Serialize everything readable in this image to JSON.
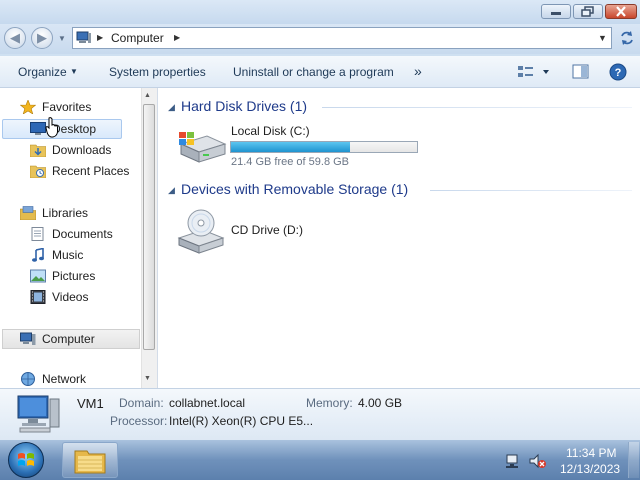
{
  "window": {
    "controls": [
      "minimize",
      "maximize",
      "close"
    ]
  },
  "address": {
    "location": "Computer",
    "separator": "▶",
    "history_arrow": "▼"
  },
  "toolbar": {
    "organize_label": "Organize",
    "system_properties_label": "System properties",
    "uninstall_label": "Uninstall or change a program",
    "more_label": "»"
  },
  "nav": {
    "favorites": "Favorites",
    "desktop": "Desktop",
    "downloads": "Downloads",
    "recent_places": "Recent Places",
    "libraries": "Libraries",
    "documents": "Documents",
    "music": "Music",
    "pictures": "Pictures",
    "videos": "Videos",
    "computer": "Computer",
    "network": "Network"
  },
  "main": {
    "hard_disk_header": "Hard Disk Drives (1)",
    "local_disk_name": "Local Disk (C:)",
    "local_disk_free": "21.4 GB free of 59.8 GB",
    "local_disk_used_fraction": 0.642,
    "removable_header": "Devices with Removable Storage (1)",
    "cd_drive_name": "CD Drive (D:)"
  },
  "details": {
    "computer_name": "VM1",
    "domain_label": "Domain:",
    "domain_value": "collabnet.local",
    "memory_label": "Memory:",
    "memory_value": "4.00 GB",
    "processor_label": "Processor:",
    "processor_value": "Intel(R) Xeon(R) CPU E5..."
  },
  "taskbar": {
    "time": "11:34 PM",
    "date": "12/13/2023"
  },
  "colors": {
    "progress_fill": "#27a0d8",
    "group_header": "#1e3a8a"
  }
}
